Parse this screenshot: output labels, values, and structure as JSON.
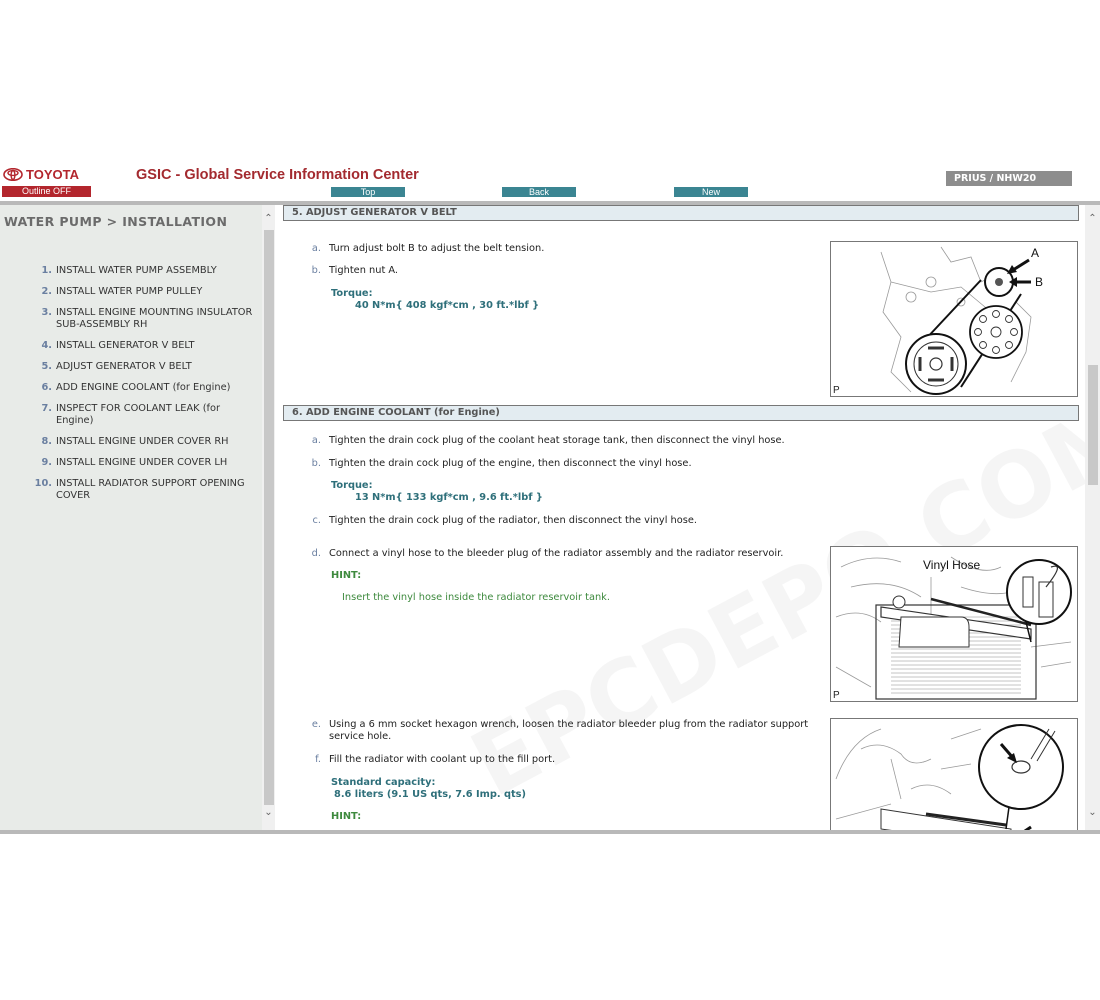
{
  "header": {
    "brand": "TOYOTA",
    "outline_button": "Outline OFF",
    "app_title": "GSIC - Global Service Information Center",
    "nav": {
      "top": "Top",
      "back": "Back",
      "new": "New"
    },
    "model": "PRIUS / NHW20",
    "colors": {
      "brand": "#b3262d",
      "nav": "#3b8592",
      "model": "#8d8d8d"
    }
  },
  "sidebar": {
    "title": "WATER PUMP > INSTALLATION",
    "items": [
      {
        "num": "1.",
        "label": "INSTALL WATER PUMP ASSEMBLY"
      },
      {
        "num": "2.",
        "label": "INSTALL WATER PUMP PULLEY"
      },
      {
        "num": "3.",
        "label": "INSTALL ENGINE MOUNTING INSULATOR SUB-ASSEMBLY RH"
      },
      {
        "num": "4.",
        "label": "INSTALL GENERATOR V BELT"
      },
      {
        "num": "5.",
        "label": "ADJUST GENERATOR V BELT"
      },
      {
        "num": "6.",
        "label": "ADD ENGINE COOLANT (for Engine)"
      },
      {
        "num": "7.",
        "label": "INSPECT FOR COOLANT LEAK (for Engine)"
      },
      {
        "num": "8.",
        "label": "INSTALL ENGINE UNDER COVER RH"
      },
      {
        "num": "9.",
        "label": "INSTALL ENGINE UNDER COVER LH"
      },
      {
        "num": "10.",
        "label": "INSTALL RADIATOR SUPPORT OPENING COVER"
      }
    ]
  },
  "scroll": {
    "up": "^",
    "down": "v"
  },
  "content": {
    "section5": {
      "title": "5. ADJUST GENERATOR V BELT",
      "steps": [
        {
          "letter": "a.",
          "text": "Turn adjust bolt B to adjust the belt tension."
        },
        {
          "letter": "b.",
          "text": "Tighten nut A."
        }
      ],
      "torque_label": "Torque:",
      "torque_value": "40 N*m{ 408 kgf*cm , 30 ft.*lbf }",
      "figure": {
        "labels": [
          "A",
          "B"
        ],
        "corner": "P"
      }
    },
    "section6": {
      "title": "6. ADD ENGINE COOLANT (for Engine)",
      "steps": [
        {
          "letter": "a.",
          "text": "Tighten the drain cock plug of the coolant heat storage tank, then disconnect the vinyl hose."
        },
        {
          "letter": "b.",
          "text": "Tighten the drain cock plug of the engine, then disconnect the vinyl hose."
        },
        {
          "letter": "c.",
          "text": "Tighten the drain cock plug of the radiator, then disconnect the vinyl hose."
        },
        {
          "letter": "d.",
          "text": "Connect a vinyl hose to the bleeder plug of the radiator assembly and the radiator reservoir."
        },
        {
          "letter": "e.",
          "text": "Using a 6 mm socket hexagon wrench, loosen the radiator bleeder plug from the radiator support service hole."
        },
        {
          "letter": "f.",
          "text": "Fill the radiator with coolant up to the fill port."
        }
      ],
      "torque_label": "Torque:",
      "torque_value": "13 N*m{ 133 kgf*cm , 9.6 ft.*lbf }",
      "hint_label": "HINT:",
      "hint_text": "Insert the vinyl hose inside the radiator reservoir tank.",
      "capacity_label": "Standard capacity:",
      "capacity_value": "8.6 liters (9.1 US qts, 7.6 Imp. qts)",
      "hint2_label": "HINT:",
      "figure_d": {
        "label": "Vinyl Hose",
        "corner": "P"
      }
    }
  },
  "watermark": "EPCDEPO.COM"
}
